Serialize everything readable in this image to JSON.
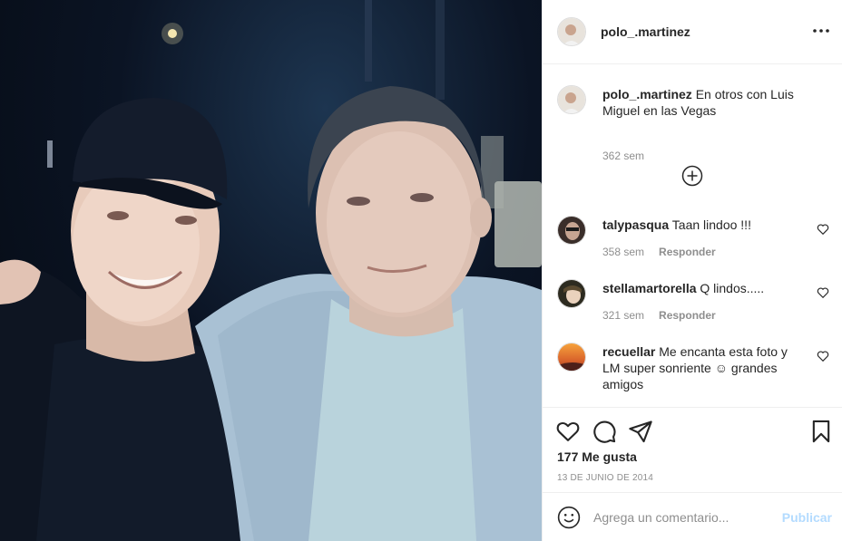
{
  "photo": {
    "description_icon": "post-photo",
    "alt": ""
  },
  "header": {
    "username": "polo_.martinez",
    "more_icon": "more-horizontal-icon"
  },
  "caption": {
    "username": "polo_.martinez",
    "text": "En otros con Luis Miguel en las Vegas",
    "time": "362 sem"
  },
  "load_more_icon": "plus-circle-icon",
  "comments": [
    {
      "username": "talypasqua",
      "text": "Taan lindoo !!!",
      "time": "358 sem",
      "reply": "Responder"
    },
    {
      "username": "stellamartorella",
      "text": "Q lindos.....",
      "time": "321 sem",
      "reply": "Responder"
    },
    {
      "username": "recuellar",
      "text": "Me encanta esta foto y LM super sonriente ☺ grandes amigos",
      "time": "",
      "reply": ""
    }
  ],
  "actions": {
    "like_icon": "heart-icon",
    "comment_icon": "comment-icon",
    "share_icon": "paper-plane-icon",
    "save_icon": "bookmark-icon"
  },
  "likes": "177 Me gusta",
  "date": "13 DE JUNIO DE 2014",
  "add_comment": {
    "placeholder": "Agrega un comentario...",
    "publish": "Publicar",
    "emoji_icon": "smiley-icon"
  },
  "colors": {
    "text": "#262626",
    "muted": "#8e8e8e",
    "border": "#efefef",
    "publish_disabled": "#b3dbff"
  }
}
